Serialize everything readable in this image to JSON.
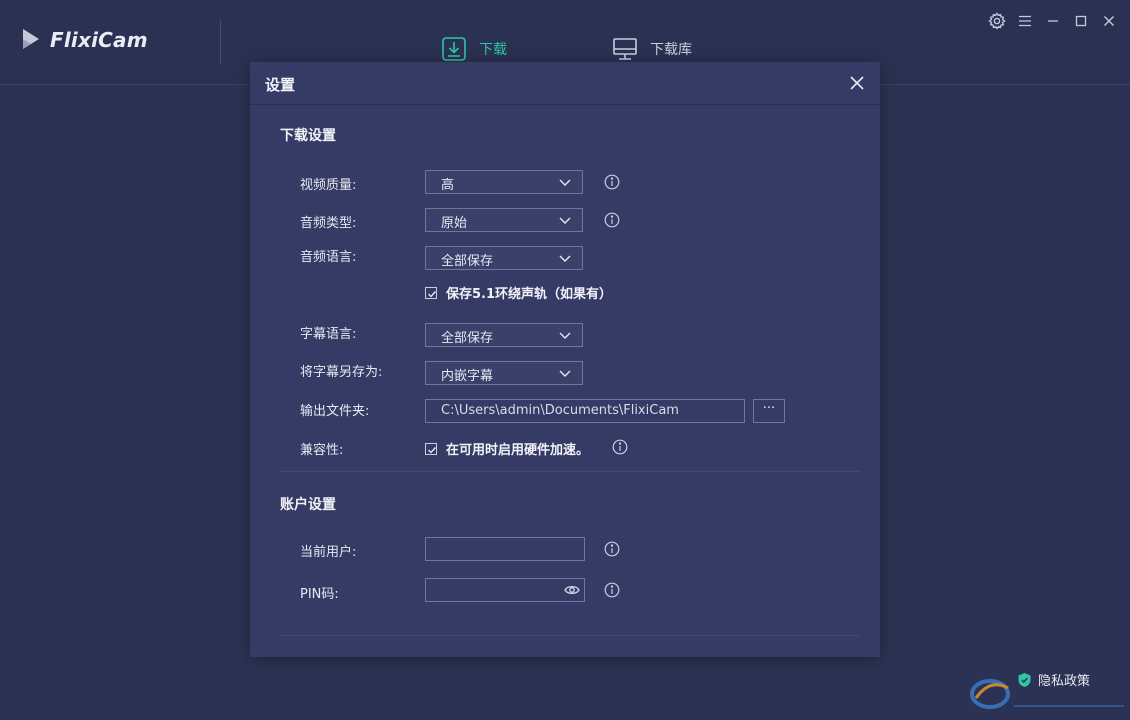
{
  "app": {
    "name": "FlixiCam"
  },
  "nav": {
    "download": "下载",
    "library": "下载库"
  },
  "dialog": {
    "title": "设置",
    "download_section": {
      "title": "下载设置",
      "video_quality": {
        "label": "视频质量:",
        "value": "高"
      },
      "audio_type": {
        "label": "音频类型:",
        "value": "原始"
      },
      "audio_language": {
        "label": "音频语言:",
        "value": "全部保存"
      },
      "save_51": {
        "label": "保存5.1环绕声轨（如果有）",
        "checked": true
      },
      "subtitle_language": {
        "label": "字幕语言:",
        "value": "全部保存"
      },
      "save_subtitle_as": {
        "label": "将字幕另存为:",
        "value": "内嵌字幕"
      },
      "output_folder": {
        "label": "输出文件夹:",
        "value": "C:\\Users\\admin\\Documents\\FlixiCam",
        "browse": "···"
      },
      "compatibility": {
        "label": "兼容性:",
        "option": "在可用时启用硬件加速。",
        "checked": true
      }
    },
    "account_section": {
      "title": "账户设置",
      "current_user": {
        "label": "当前用户:",
        "value": ""
      },
      "pin": {
        "label": "PIN码:",
        "value": ""
      }
    }
  },
  "footer": {
    "privacy": "隐私政策"
  },
  "colors": {
    "accent": "#2fc7a3",
    "background": "#2c3253",
    "dialog": "#353b64"
  }
}
